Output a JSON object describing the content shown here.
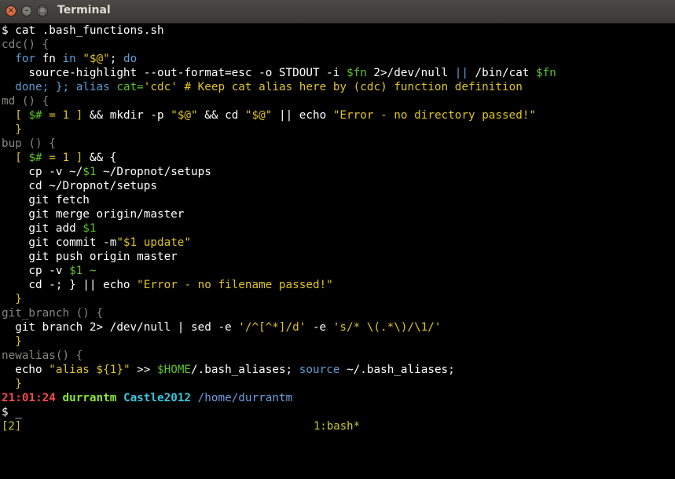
{
  "window": {
    "title": "Terminal"
  },
  "terminal": {
    "lines": [
      [
        {
          "t": "$ cat .bash_functions.sh",
          "c": ""
        }
      ],
      [
        {
          "t": "cdc() {",
          "c": "cm"
        }
      ],
      [
        {
          "t": "  ",
          "c": ""
        },
        {
          "t": "for",
          "c": "kw"
        },
        {
          "t": " fn ",
          "c": ""
        },
        {
          "t": "in",
          "c": "kw"
        },
        {
          "t": " ",
          "c": ""
        },
        {
          "t": "\"$@\"",
          "c": "st"
        },
        {
          "t": "; ",
          "c": ""
        },
        {
          "t": "do",
          "c": "kw"
        }
      ],
      [
        {
          "t": "    source-highlight --out-format=esc -o STDOUT -i ",
          "c": ""
        },
        {
          "t": "$fn",
          "c": "vr"
        },
        {
          "t": " 2>/dev/null ",
          "c": ""
        },
        {
          "t": "||",
          "c": "kw"
        },
        {
          "t": " /bin/cat ",
          "c": ""
        },
        {
          "t": "$fn",
          "c": "vr"
        }
      ],
      [
        {
          "t": "  ",
          "c": ""
        },
        {
          "t": "done",
          "c": "kw"
        },
        {
          "t": "; }; ",
          "c": "kw"
        },
        {
          "t": "alias",
          "c": "kw"
        },
        {
          "t": " ",
          "c": ""
        },
        {
          "t": "cat=",
          "c": "vr"
        },
        {
          "t": "'cdc'",
          "c": "st"
        },
        {
          "t": " # Keep cat alias here by (cdc) function definition",
          "c": "st"
        }
      ],
      [
        {
          "t": "md () {",
          "c": "cm"
        }
      ],
      [
        {
          "t": "  [ ",
          "c": "st"
        },
        {
          "t": "$#",
          "c": "vr"
        },
        {
          "t": " = 1 ] ",
          "c": "st"
        },
        {
          "t": "&& mkdir -p ",
          "c": ""
        },
        {
          "t": "\"$@\"",
          "c": "st"
        },
        {
          "t": " && cd ",
          "c": ""
        },
        {
          "t": "\"$@\"",
          "c": "st"
        },
        {
          "t": " || echo ",
          "c": ""
        },
        {
          "t": "\"Error - no directory passed!\"",
          "c": "st"
        }
      ],
      [
        {
          "t": "  }",
          "c": "st"
        }
      ],
      [
        {
          "t": "bup () {",
          "c": "cm"
        }
      ],
      [
        {
          "t": "  [ ",
          "c": "st"
        },
        {
          "t": "$#",
          "c": "vr"
        },
        {
          "t": " = 1 ] ",
          "c": "st"
        },
        {
          "t": "&& {",
          "c": ""
        }
      ],
      [
        {
          "t": "    cp -v ~/",
          "c": ""
        },
        {
          "t": "$1",
          "c": "vr"
        },
        {
          "t": " ~/Dropnot/setups",
          "c": ""
        }
      ],
      [
        {
          "t": "    cd ~/Dropnot/setups",
          "c": ""
        }
      ],
      [
        {
          "t": "    git fetch",
          "c": ""
        }
      ],
      [
        {
          "t": "    git merge origin/master",
          "c": ""
        }
      ],
      [
        {
          "t": "    git add ",
          "c": ""
        },
        {
          "t": "$1",
          "c": "vr"
        }
      ],
      [
        {
          "t": "    git commit -m",
          "c": ""
        },
        {
          "t": "\"$1 update\"",
          "c": "st"
        }
      ],
      [
        {
          "t": "    git push origin master",
          "c": ""
        }
      ],
      [
        {
          "t": "    cp -v ",
          "c": ""
        },
        {
          "t": "$1 ~",
          "c": "vr"
        }
      ],
      [
        {
          "t": "    cd -; } || echo ",
          "c": ""
        },
        {
          "t": "\"Error - no filename passed!\"",
          "c": "st"
        }
      ],
      [
        {
          "t": "  }",
          "c": "st"
        }
      ],
      [
        {
          "t": "git_branch () {",
          "c": "cm"
        }
      ],
      [
        {
          "t": "  git branch 2> /dev/null | sed -e ",
          "c": ""
        },
        {
          "t": "'/^[^*]/d'",
          "c": "st"
        },
        {
          "t": " -e ",
          "c": ""
        },
        {
          "t": "'s/* \\(.*\\)/\\1/'",
          "c": "st"
        }
      ],
      [
        {
          "t": "  }",
          "c": "st"
        }
      ],
      [
        {
          "t": "newalias() {",
          "c": "cm"
        }
      ],
      [
        {
          "t": "  echo ",
          "c": ""
        },
        {
          "t": "\"alias ${1}\"",
          "c": "st"
        },
        {
          "t": " >> ",
          "c": ""
        },
        {
          "t": "$HOME",
          "c": "vr"
        },
        {
          "t": "/.bash_aliases; ",
          "c": ""
        },
        {
          "t": "source",
          "c": "kw"
        },
        {
          "t": " ~/.bash_aliases;",
          "c": ""
        }
      ],
      [
        {
          "t": "  }",
          "c": "st"
        }
      ]
    ],
    "prompt": {
      "time": "21:01:24",
      "user": "durrantm",
      "host": "Castle2012",
      "path": "/home/durrantm"
    },
    "input_line": "$ _"
  },
  "statusbar": {
    "left": "[2]",
    "center": "1:bash*"
  }
}
